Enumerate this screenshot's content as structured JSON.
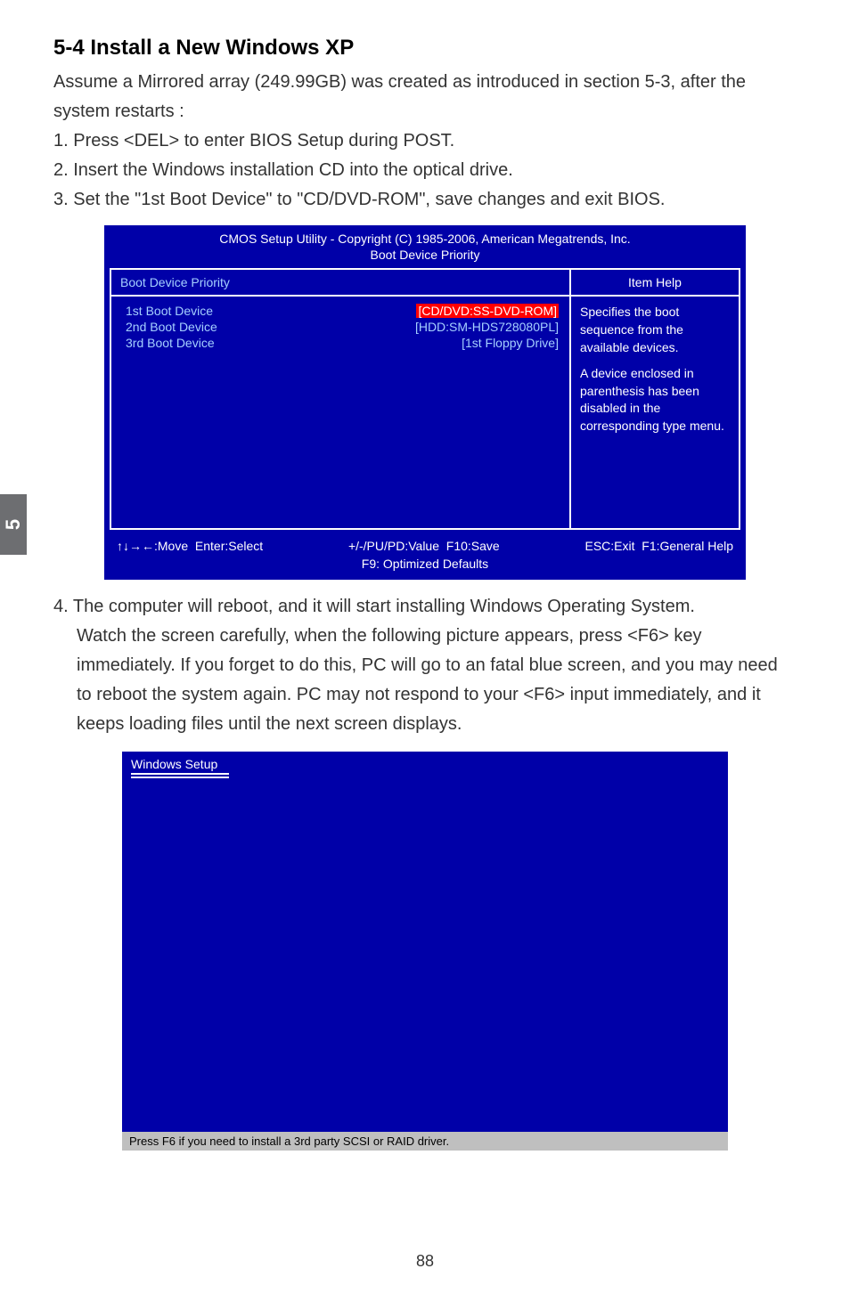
{
  "sideTab": "5",
  "heading": "5-4 Install a New Windows XP",
  "intro": "Assume a Mirrored array (249.99GB) was created as introduced in section 5-3, after the system restarts :",
  "step1": "1. Press <DEL> to enter BIOS Setup during POST.",
  "step2": "2. Insert the Windows installation CD into the optical drive.",
  "step3": "3. Set the \"1st Boot Device\" to \"CD/DVD-ROM\", save changes and exit BIOS.",
  "bios": {
    "title1": "CMOS Setup Utility - Copyright (C) 1985-2006, American Megatrends, Inc.",
    "title2": "Boot Device Priority",
    "headerLeft": "Boot Device Priority",
    "headerRight": "Item Help",
    "dev1": "1st Boot Device",
    "dev2": "2nd Boot Device",
    "dev3": "3rd Boot Device",
    "val1": "[CD/DVD:SS-DVD-ROM]",
    "val2": "[HDD:SM-HDS728080PL]",
    "val3": "[1st Floppy Drive]",
    "help1": "Specifies the boot sequence from the available devices.",
    "help2": "A device enclosed in parenthesis has been disabled in the corresponding type menu.",
    "footerMove": "↑↓→←:Move",
    "footerEnter": "Enter:Select",
    "footerVal": "+/-/PU/PD:Value",
    "footerSave": "F10:Save",
    "footerEsc": "ESC:Exit",
    "footerHelp": "F1:General Help",
    "footerDefaults": "F9: Optimized Defaults"
  },
  "step4a": "4. The computer will reboot, and it will start installing Windows Operating System.",
  "step4b": "Watch the screen carefully, when the following picture appears, press <F6> key immediately. If you forget to do this, PC will go to an fatal blue screen, and you may need to reboot the system again. PC may not respond to your <F6> input immediately, and it keeps loading files until the next screen displays.",
  "setup": {
    "title": "Windows Setup",
    "footer": "Press F6 if you need to install a 3rd party SCSI or RAID driver."
  },
  "pageNum": "88"
}
